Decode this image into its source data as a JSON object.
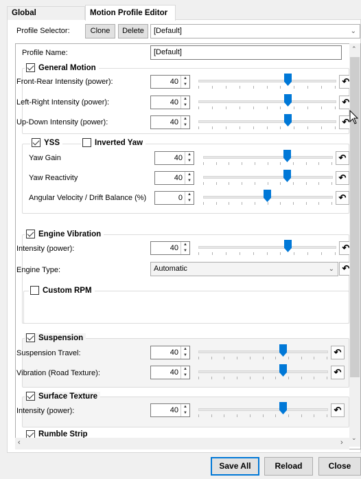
{
  "tabs": [
    {
      "label": "Global Parameters"
    },
    {
      "label": "Motion Profile Editor"
    }
  ],
  "profile_selector": {
    "label": "Profile Selector:",
    "clone": "Clone",
    "delete": "Delete",
    "value": "[Default]"
  },
  "profile_name": {
    "label": "Profile Name:",
    "value": "[Default]"
  },
  "general_motion": {
    "title": "General Motion",
    "checked": true,
    "rows": [
      {
        "label": "Front-Rear Intensity (power):",
        "value": "40",
        "level": 0.66
      },
      {
        "label": "Left-Right Intensity (power):",
        "value": "40",
        "level": 0.66
      },
      {
        "label": "Up-Down Intensity (power):",
        "value": "40",
        "level": 0.66
      }
    ]
  },
  "yss": {
    "title": "YSS",
    "checked": true,
    "inverted_yaw": {
      "label": "Inverted Yaw",
      "checked": false
    },
    "rows": [
      {
        "label": "Yaw Gain",
        "value": "40",
        "level": 0.66
      },
      {
        "label": "Yaw Reactivity",
        "value": "40",
        "level": 0.66
      },
      {
        "label": "Angular Velocity / Drift Balance (%)",
        "value": "0",
        "level": 0.5
      }
    ]
  },
  "engine_vibration": {
    "title": "Engine Vibration",
    "checked": true,
    "intensity": {
      "label": "Intensity (power):",
      "value": "40",
      "level": 0.66
    },
    "engine_type": {
      "label": "Engine Type:",
      "value": "Automatic"
    },
    "custom_rpm": {
      "label": "Custom RPM",
      "checked": false
    }
  },
  "suspension": {
    "title": "Suspension",
    "checked": true,
    "rows": [
      {
        "label": "Suspension Travel:",
        "value": "40",
        "level": 0.66
      },
      {
        "label": "Vibration (Road Texture):",
        "value": "40",
        "level": 0.66
      }
    ]
  },
  "surface_texture": {
    "title": "Surface Texture",
    "checked": true,
    "rows": [
      {
        "label": "Intensity (power):",
        "value": "40",
        "level": 0.66
      }
    ]
  },
  "rumble_strip": {
    "title": "Rumble Strip",
    "checked": true
  },
  "footer": {
    "save_all": "Save All",
    "reload": "Reload",
    "close": "Close"
  },
  "icons": {
    "reset": "reset-icon",
    "spin": "spinner-arrows-icon",
    "dropdown": "chevron-down-icon"
  }
}
